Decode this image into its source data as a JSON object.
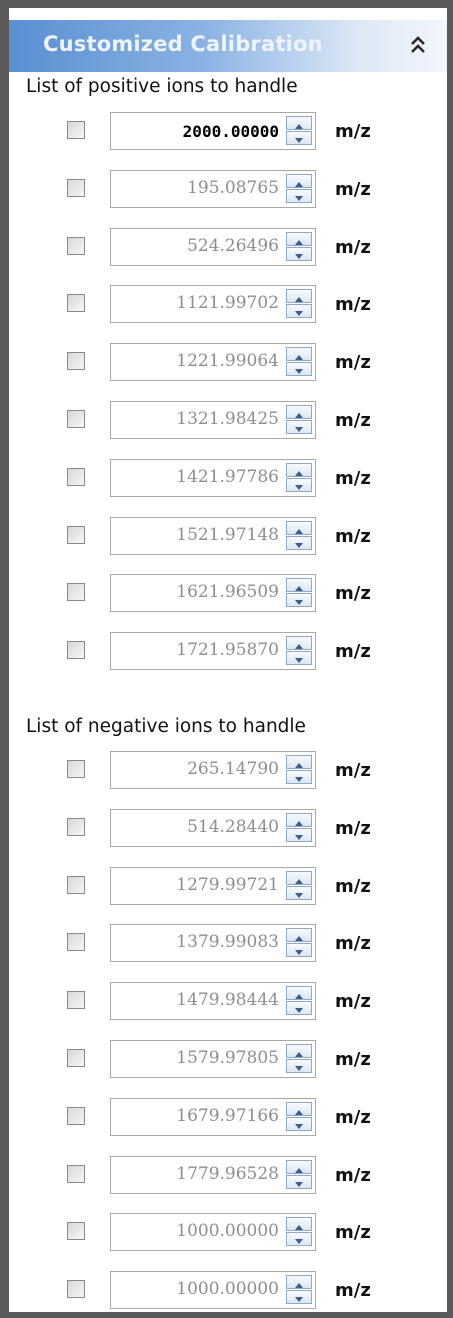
{
  "panel": {
    "title": "Customized Calibration"
  },
  "positive": {
    "label": "List of positive ions to handle",
    "rows": [
      {
        "value": "2000.00000",
        "unit": "m/z",
        "checked": false
      },
      {
        "value": "195.08765",
        "unit": "m/z",
        "checked": false
      },
      {
        "value": "524.26496",
        "unit": "m/z",
        "checked": false
      },
      {
        "value": "1121.99702",
        "unit": "m/z",
        "checked": false
      },
      {
        "value": "1221.99064",
        "unit": "m/z",
        "checked": false
      },
      {
        "value": "1321.98425",
        "unit": "m/z",
        "checked": false
      },
      {
        "value": "1421.97786",
        "unit": "m/z",
        "checked": false
      },
      {
        "value": "1521.97148",
        "unit": "m/z",
        "checked": false
      },
      {
        "value": "1621.96509",
        "unit": "m/z",
        "checked": false
      },
      {
        "value": "1721.95870",
        "unit": "m/z",
        "checked": false
      }
    ]
  },
  "negative": {
    "label": "List of negative ions to handle",
    "rows": [
      {
        "value": "265.14790",
        "unit": "m/z",
        "checked": false
      },
      {
        "value": "514.28440",
        "unit": "m/z",
        "checked": false
      },
      {
        "value": "1279.99721",
        "unit": "m/z",
        "checked": false
      },
      {
        "value": "1379.99083",
        "unit": "m/z",
        "checked": false
      },
      {
        "value": "1479.98444",
        "unit": "m/z",
        "checked": false
      },
      {
        "value": "1579.97805",
        "unit": "m/z",
        "checked": false
      },
      {
        "value": "1679.97166",
        "unit": "m/z",
        "checked": false
      },
      {
        "value": "1779.96528",
        "unit": "m/z",
        "checked": false
      },
      {
        "value": "1000.00000",
        "unit": "m/z",
        "checked": false
      },
      {
        "value": "1000.00000",
        "unit": "m/z",
        "checked": false
      }
    ]
  },
  "icons": {
    "collapse": "double-chevron-up-icon",
    "spin_up": "arrow-up-icon",
    "spin_down": "arrow-down-icon"
  },
  "colors": {
    "header_accent": "#5a8fd2",
    "frame": "#5a5a5a",
    "inactive_value": "#8e8e8e"
  }
}
